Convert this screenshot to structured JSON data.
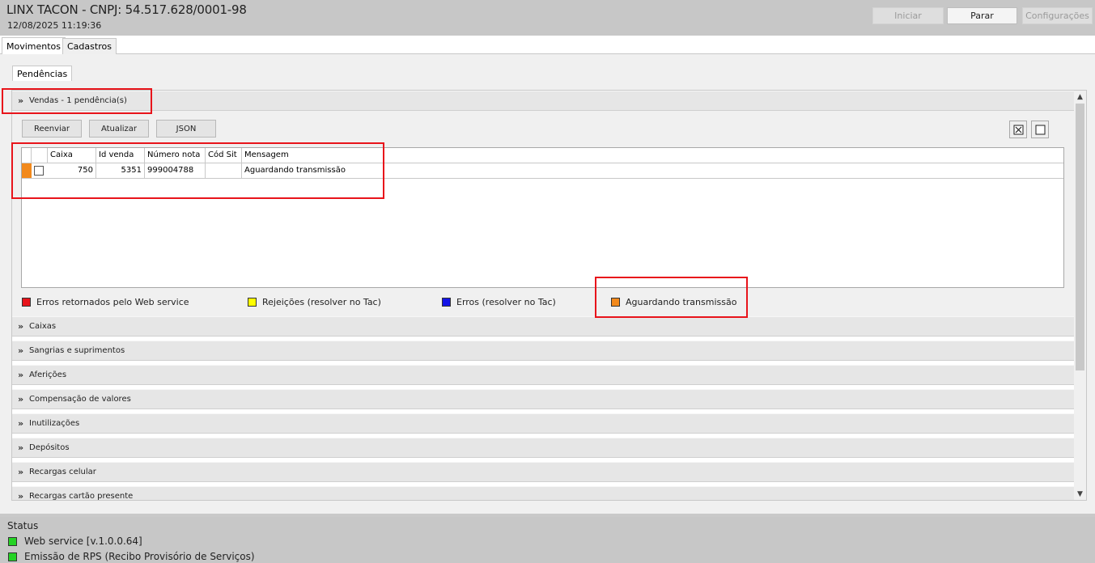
{
  "header": {
    "title": "LINX TACON - CNPJ: 54.517.628/0001-98",
    "datetime": "12/08/2025 11:19:36",
    "buttons": {
      "start": "Iniciar",
      "stop": "Parar",
      "settings": "Configurações"
    }
  },
  "tabs": [
    "Movimentos",
    "Cadastros"
  ],
  "subtab": "Pendências",
  "sales_section": {
    "title": "Vendas - 1 pendência(s)",
    "buttons": {
      "resend": "Reenviar",
      "refresh": "Atualizar",
      "json": "JSON"
    },
    "columns": [
      "Caixa",
      "Id venda",
      "Número nota",
      "Cód Sit",
      "Mensagem"
    ],
    "rows": [
      {
        "caixa": "750",
        "id_venda": "5351",
        "numero_nota": "999004788",
        "cod_sit": "",
        "mensagem": "Aguardando transmissão",
        "status_color": "#f2891c"
      }
    ]
  },
  "legend": [
    {
      "label": "Erros retornados pelo Web service",
      "color": "#e8141b"
    },
    {
      "label": "Rejeições (resolver no Tac)",
      "color": "#ffff00"
    },
    {
      "label": "Erros (resolver no Tac)",
      "color": "#1414e8"
    },
    {
      "label": "Aguardando transmissão",
      "color": "#f2891c"
    }
  ],
  "sections": [
    "Caixas",
    "Sangrias e suprimentos",
    "Aferições",
    "Compensação de valores",
    "Inutilizações",
    "Depósitos",
    "Recargas celular",
    "Recargas cartão presente"
  ],
  "status": {
    "title": "Status",
    "items": [
      {
        "label": "Web service [v.1.0.0.64]",
        "color": "#25d325"
      },
      {
        "label": "Emissão de RPS (Recibo Provisório de Serviços)",
        "color": "#25d325"
      }
    ]
  }
}
